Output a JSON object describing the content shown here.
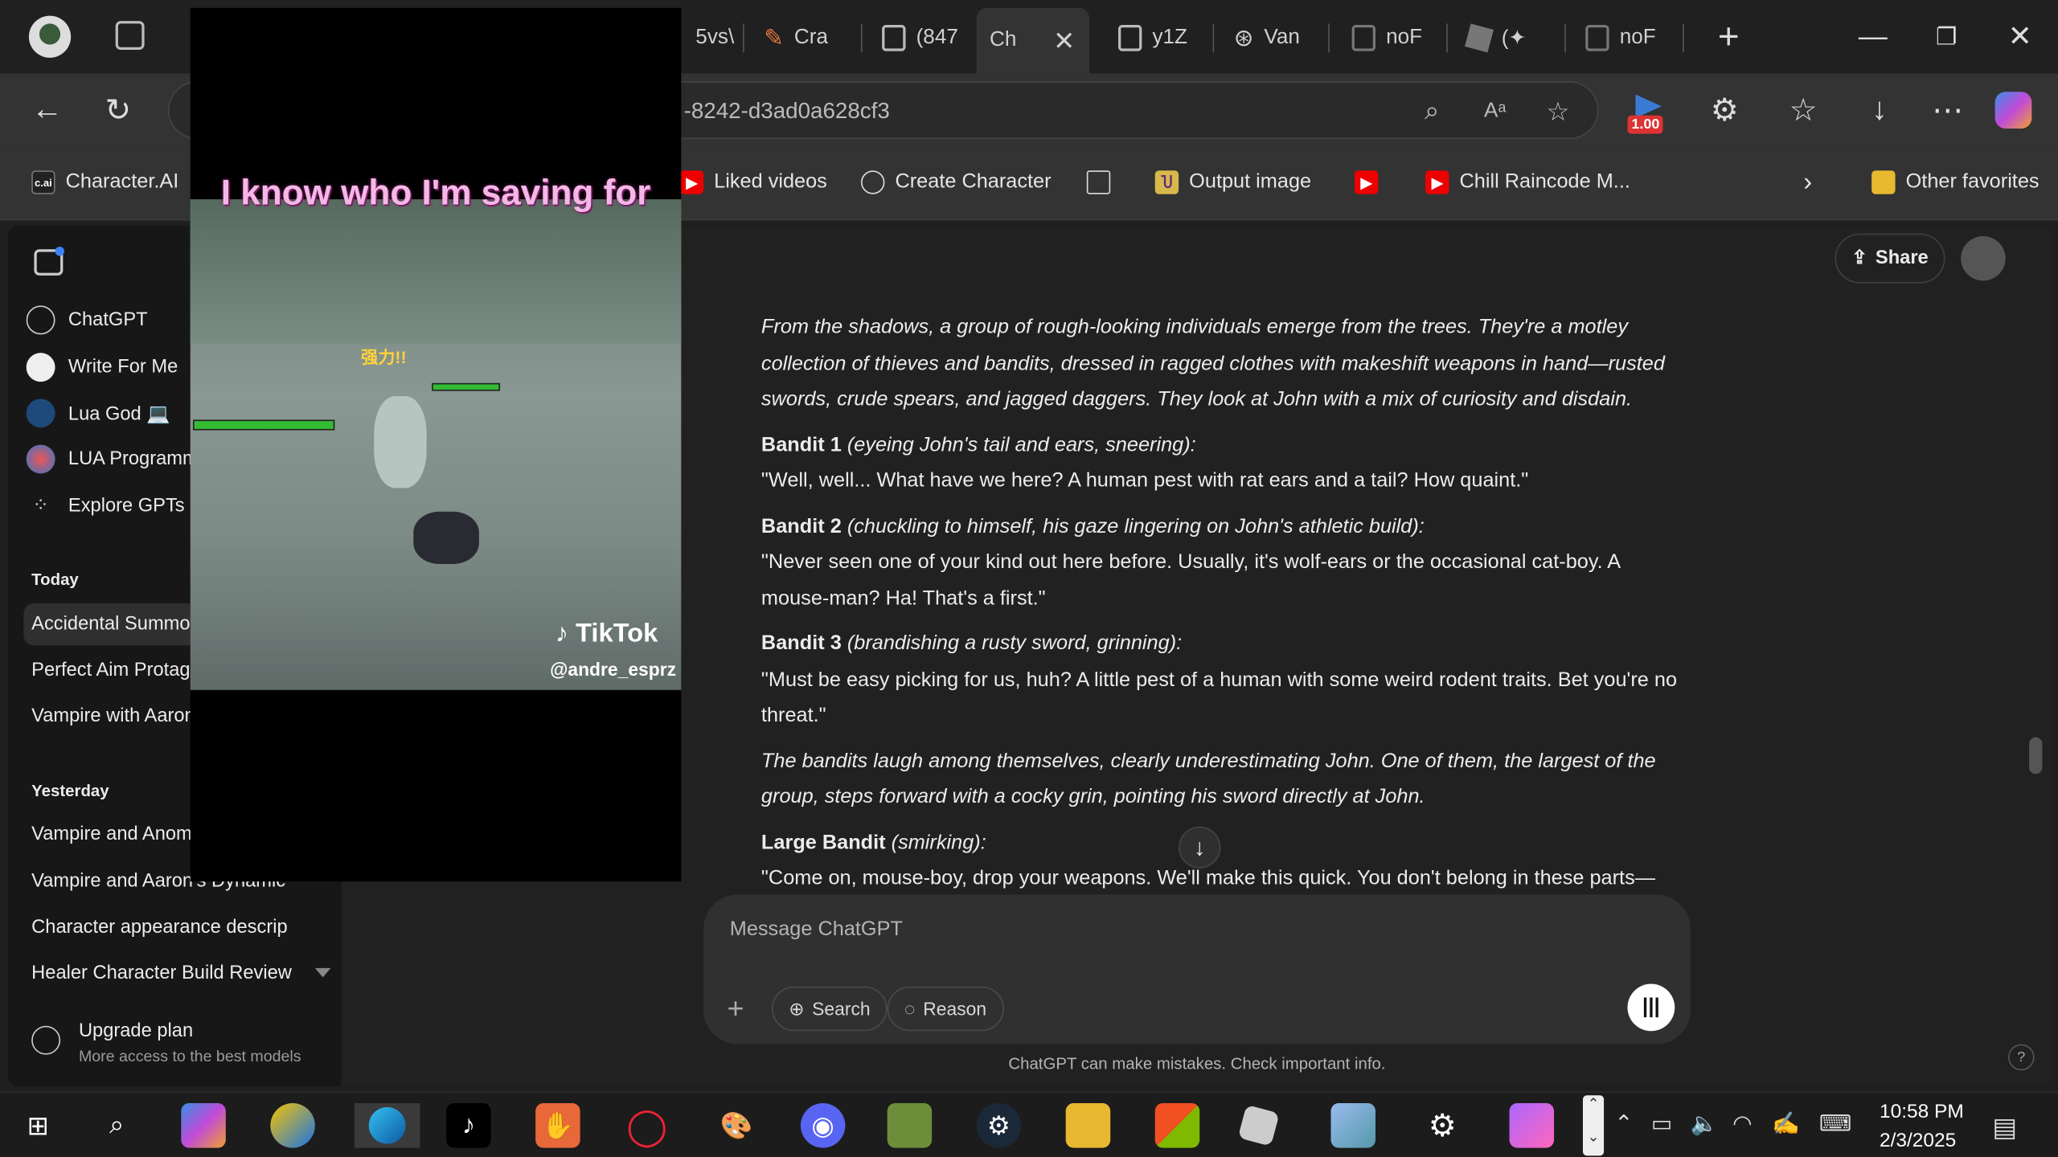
{
  "browser": {
    "tabs": [
      {
        "label": "5vs\\"
      },
      {
        "label": "Cra"
      },
      {
        "label": "(847"
      },
      {
        "label": "Ch"
      },
      {
        "label": "y1Z"
      },
      {
        "label": "Van"
      },
      {
        "label": "noF"
      },
      {
        "label": "(✦"
      },
      {
        "label": "noF"
      }
    ],
    "address": "-8242-d3ad0a628cf3",
    "extension_badge": "1.00",
    "favorites": [
      {
        "label": "Character.AI"
      },
      {
        "label": "Liked videos"
      },
      {
        "label": "Create Character"
      },
      {
        "label": "Output image"
      },
      {
        "label": "Chill Raincode M..."
      },
      {
        "label": "Other favorites"
      }
    ]
  },
  "sidebar": {
    "gpts": [
      {
        "label": "ChatGPT"
      },
      {
        "label": "Write For Me"
      },
      {
        "label": "Lua God 💻"
      },
      {
        "label": "LUA Programmer"
      },
      {
        "label": "Explore GPTs"
      }
    ],
    "today_heading": "Today",
    "today": [
      {
        "label": "Accidental Summoning"
      },
      {
        "label": "Perfect Aim Protagonist"
      },
      {
        "label": "Vampire with Aaron"
      }
    ],
    "yesterday_heading": "Yesterday",
    "yesterday": [
      {
        "label": "Vampire and Anomaly"
      },
      {
        "label": "Vampire and Aaron's Dynamic"
      },
      {
        "label": "Character appearance descrip"
      },
      {
        "label": "Healer Character Build Review"
      }
    ],
    "upgrade_title": "Upgrade plan",
    "upgrade_sub": "More access to the best models"
  },
  "main": {
    "share_label": "Share",
    "messages": {
      "p1": "From the shadows, a group of rough-looking individuals emerge from the trees. They're a motley collection of thieves and bandits, dressed in ragged clothes with makeshift weapons in hand—rusted swords, crude spears, and jagged daggers. They look at John with a mix of curiosity and disdain.",
      "b1_name": "Bandit 1",
      "b1_action": " (eyeing John's tail and ears, sneering):",
      "b1_line": "\"Well, well... What have we here? A human pest with rat ears and a tail? How quaint.\"",
      "b2_name": "Bandit 2",
      "b2_action": " (chuckling to himself, his gaze lingering on John's athletic build):",
      "b2_line": "\"Never seen one of your kind out here before. Usually, it's wolf-ears or the occasional cat-boy. A mouse-man? Ha! That's a first.\"",
      "b3_name": "Bandit 3",
      "b3_action": " (brandishing a rusty sword, grinning):",
      "b3_line": "\"Must be easy picking for us, huh? A little pest of a human with some weird rodent traits. Bet you're no threat.\"",
      "p2": "The bandits laugh among themselves, clearly underestimating John. One of them, the largest of the group, steps forward with a cocky grin, pointing his sword directly at John.",
      "lb_name": "Large Bandit",
      "lb_action": " (smirking):",
      "lb_line": "\"Come on, mouse-boy, drop your weapons. We'll make this quick. You don't belong in these parts—"
    },
    "composer_placeholder": "Message ChatGPT",
    "search_label": "Search",
    "reason_label": "Reason",
    "disclaimer": "ChatGPT can make mistakes. Check important info.",
    "help": "?"
  },
  "video": {
    "caption": "I know who I'm saving for",
    "brand": "TikTok",
    "handle": "@andre_esprz",
    "hud_text": "强力!!"
  },
  "taskbar": {
    "time": "10:58 PM",
    "date": "2/3/2025"
  }
}
